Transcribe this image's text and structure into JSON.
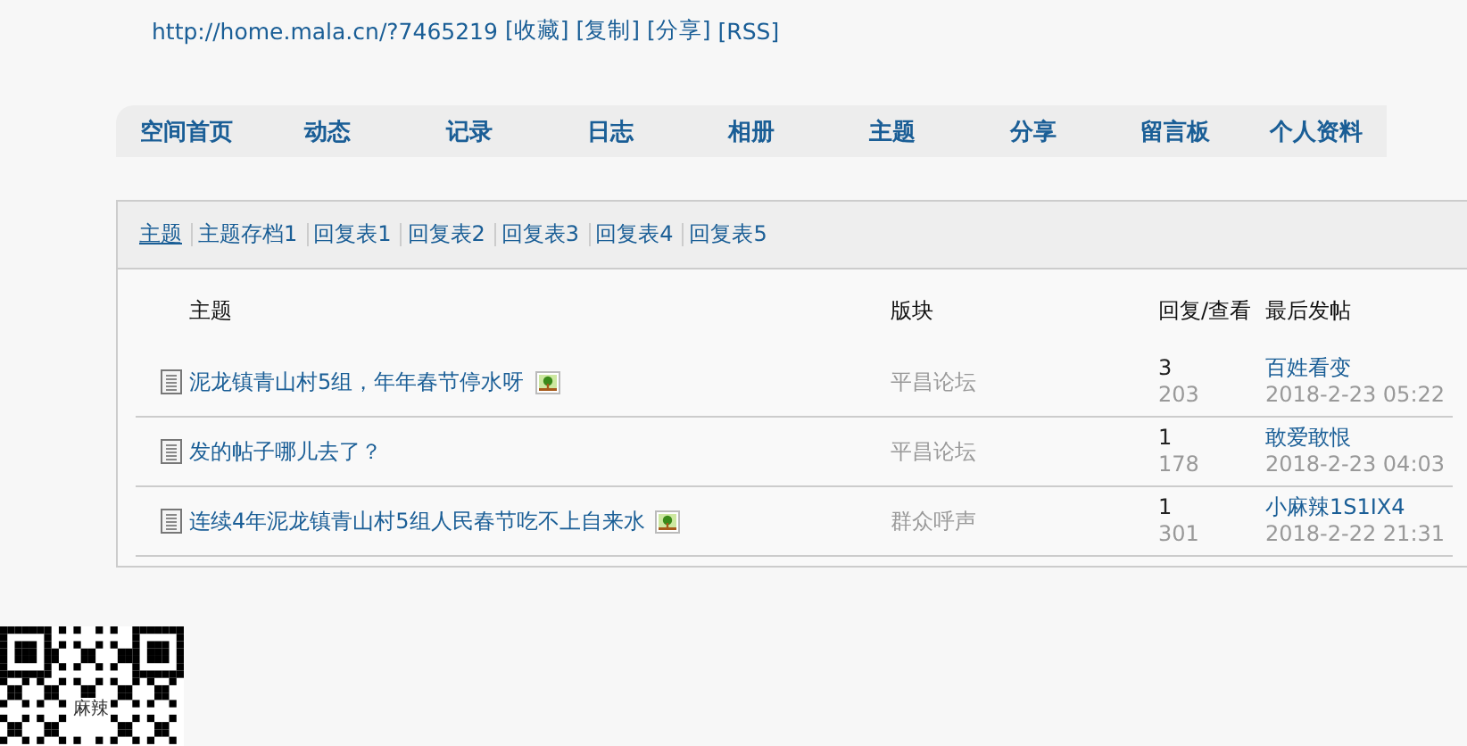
{
  "header": {
    "url": "http://home.mala.cn/?7465219",
    "links": [
      "[收藏]",
      "[复制]",
      "[分享]",
      "[RSS]"
    ]
  },
  "nav": [
    "空间首页",
    "动态",
    "记录",
    "日志",
    "相册",
    "主题",
    "分享",
    "留言板",
    "个人资料"
  ],
  "tabs": [
    {
      "label": "主题",
      "selected": true
    },
    {
      "label": "主题存档1",
      "selected": false
    },
    {
      "label": "回复表1",
      "selected": false
    },
    {
      "label": "回复表2",
      "selected": false
    },
    {
      "label": "回复表3",
      "selected": false
    },
    {
      "label": "回复表4",
      "selected": false
    },
    {
      "label": "回复表5",
      "selected": false
    }
  ],
  "table": {
    "columns": [
      "主题",
      "版块",
      "回复/查看",
      "最后发帖"
    ],
    "rows": [
      {
        "title": "泥龙镇青山村5组，年年春节停水呀",
        "has_image": true,
        "forum": "平昌论坛",
        "replies": "3",
        "views": "203",
        "last_user": "百姓看变",
        "last_time": "2018-2-23 05:22"
      },
      {
        "title": "发的帖子哪儿去了？",
        "has_image": false,
        "forum": "平昌论坛",
        "replies": "1",
        "views": "178",
        "last_user": "敢爱敢恨",
        "last_time": "2018-2-23 04:03"
      },
      {
        "title": "连续4年泥龙镇青山村5组人民春节吃不上自来水",
        "has_image": true,
        "forum": "群众呼声",
        "replies": "1",
        "views": "301",
        "last_user": "小麻辣1S1IX4",
        "last_time": "2018-2-22 21:31"
      }
    ]
  },
  "qr": {
    "logo": "麻辣"
  }
}
